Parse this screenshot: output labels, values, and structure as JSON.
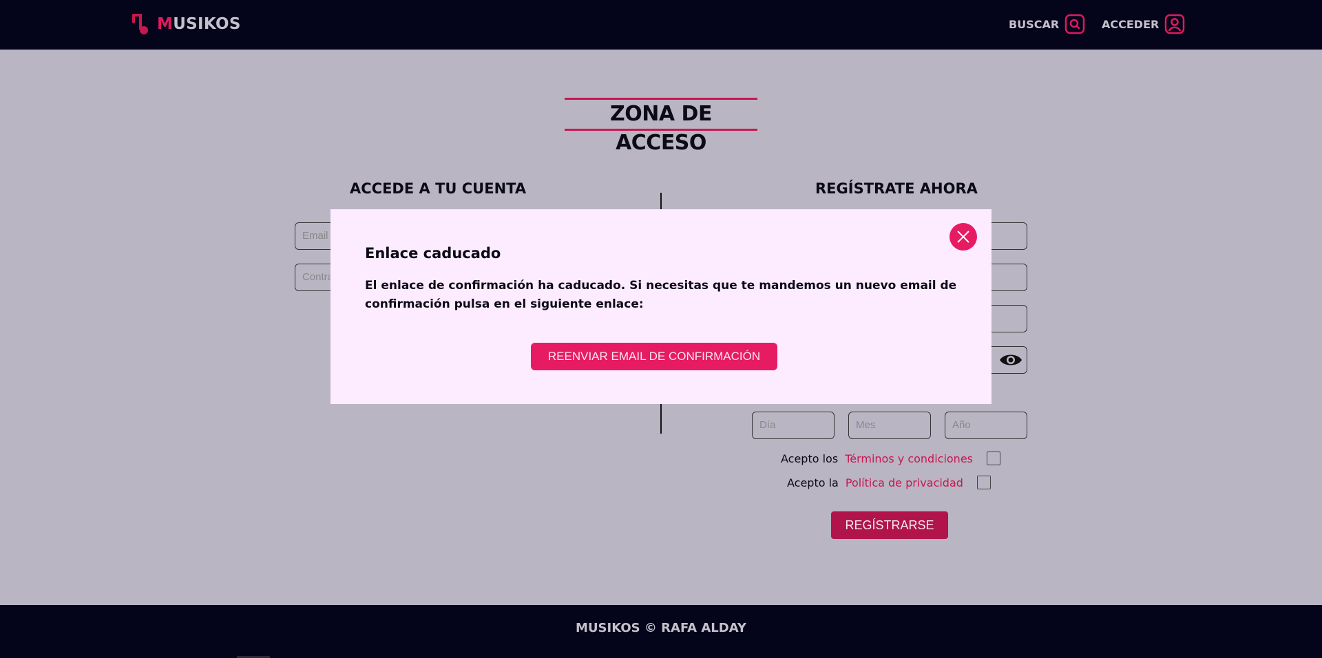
{
  "header": {
    "logo_initial": "M",
    "logo_rest": "USIKOS",
    "nav": {
      "search_label": "BUSCAR",
      "login_label": "ACCEDER"
    },
    "icons": {
      "logo": "music-note-icon",
      "search": "search-icon",
      "login": "user-icon"
    },
    "accent_color": "#e0195f"
  },
  "main": {
    "page_title": "ZONA DE ACCESO",
    "login": {
      "title": "ACCEDE A TU CUENTA",
      "email_placeholder": "Email",
      "password_placeholder": "Contra"
    },
    "register": {
      "title": "REGÍSTRATE AHORA",
      "date": {
        "day_placeholder": "Día",
        "month_placeholder": "Mes",
        "year_placeholder": "Año"
      },
      "terms_prefix": "Acepto los",
      "terms_link": "Términos y condiciones",
      "privacy_prefix": "Acepto la",
      "privacy_link": "Política de privacidad",
      "submit_label": "REGÍSTRARSE"
    }
  },
  "modal": {
    "title": "Enlace caducado",
    "body": "El enlace de confirmación ha caducado. Si necesitas que te mandemos un nuevo email de confirmación pulsa en el siguiente enlace:",
    "resend_label": "REENVIAR EMAIL DE CONFIRMACIÓN",
    "close_icon": "close-icon"
  },
  "footer": {
    "text": "MUSIKOS © RAFA ALDAY"
  }
}
